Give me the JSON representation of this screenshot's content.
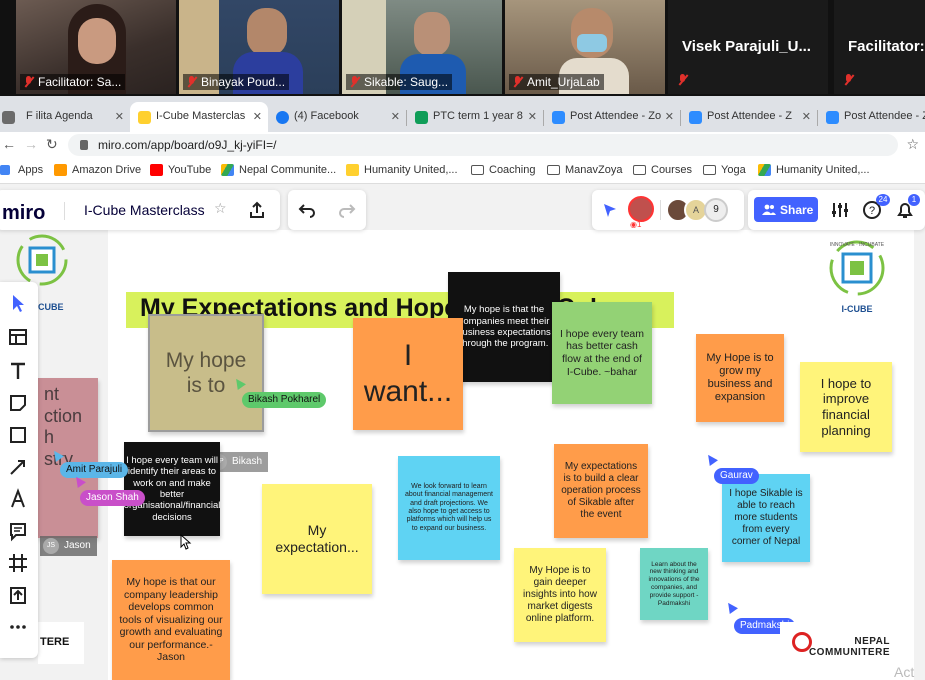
{
  "zoom": {
    "participants": [
      {
        "label": "Facilitator: Sa...",
        "bg": "#5a4a44"
      },
      {
        "label": "Binayak Poud...",
        "bg": "#3e4c63"
      },
      {
        "label": "Sikable: Saug...",
        "bg": "#4b5a55"
      },
      {
        "label": "Amit_UrjaLab",
        "bg": "#7a6a58"
      }
    ],
    "name_tiles": [
      "Visek Parajuli_U...",
      "Facilitator:"
    ]
  },
  "tabs": [
    {
      "label": "F   ilita   Agenda",
      "fav": "#6b6b6b"
    },
    {
      "label": "I-Cube Masterclas",
      "fav": "#ffd02f",
      "active": true
    },
    {
      "label": "(4) Facebook",
      "fav": "#1877f2"
    },
    {
      "label": "PTC term 1 year 8",
      "fav": "#0f9d58"
    },
    {
      "label": "Post Attendee - Zo",
      "fav": "#2d8cff"
    },
    {
      "label": "Post Attendee - Z",
      "fav": "#2d8cff"
    },
    {
      "label": "Post Attendee - Z",
      "fav": "#2d8cff"
    }
  ],
  "address": {
    "url": "miro.com/app/board/o9J_kj-yiFI=/"
  },
  "bookmarks": [
    {
      "label": "Apps",
      "color": "#4285f4",
      "folder": false
    },
    {
      "label": "Amazon Drive",
      "color": "#ff9900",
      "folder": false
    },
    {
      "label": "YouTube",
      "color": "#ff0000",
      "folder": false
    },
    {
      "label": "Nepal Communite...",
      "color": "#34a853",
      "folder": false
    },
    {
      "label": "Humanity United,...",
      "color": "#ffd02f",
      "folder": false
    },
    {
      "label": "Coaching",
      "color": "#555",
      "folder": true
    },
    {
      "label": "ManavZoya",
      "color": "#555",
      "folder": true
    },
    {
      "label": "Courses",
      "color": "#555",
      "folder": true
    },
    {
      "label": "Yoga",
      "color": "#555",
      "folder": true
    },
    {
      "label": "Humanity United,...",
      "color": "#34a853",
      "folder": false
    }
  ],
  "miro": {
    "logo": "miro",
    "board_title": "I-Cube Masterclass",
    "share_label": "Share",
    "online_count": "9",
    "eye_count": "1",
    "help_badge": "24",
    "notif_badge": "1",
    "accent": "#4262ff"
  },
  "board": {
    "heading": "My Expectations and Hopes from I-Cube",
    "logo_text": "CUBE",
    "logo_caption": "I-CUBE",
    "logo_arc": "INNOVATE · INCUBATE",
    "left_partial_text": "nt\nction\nh\nstry",
    "left_partial_user": "Jason",
    "partial_logo_text": "TERE",
    "stickies": [
      {
        "text": "My hope is to",
        "bg": "#c8bd8a"
      },
      {
        "text": "My hope is that the companies meet their business expectations through the program.",
        "bg": "#111111"
      },
      {
        "text": "I want...",
        "bg": "#ff9c4a"
      },
      {
        "text": "I hope every team has better cash flow at the end of I-Cube. ~bahar",
        "bg": "#93d275"
      },
      {
        "text": "My Hope is to grow my business and expansion",
        "bg": "#ff9c4a"
      },
      {
        "text": "I hope to improve financial planning",
        "bg": "#fff47a"
      },
      {
        "text": "I hope every team will identify their areas to work on and make better organisational/financial decisions",
        "bg": "#111111"
      },
      {
        "text": "My expectation...",
        "bg": "#fff47a"
      },
      {
        "text": "We look forward to learn about financial management and draft projections. We also hope to get access to platforms which will help us to expand our business.",
        "bg": "#5fd3f3"
      },
      {
        "text": "My expectations is to build a clear operation process of Sikable after the event",
        "bg": "#ff9c4a"
      },
      {
        "text": "I hope Sikable is able to reach more students from every corner of Nepal",
        "bg": "#5fd3f3"
      },
      {
        "text": "My hope is that our company leadership develops common tools of visualizing our growth and evaluating our performance.-Jason",
        "bg": "#ff9c4a"
      },
      {
        "text": "My Hope is to gain deeper insights into how market digests online platform.",
        "bg": "#fff47a"
      },
      {
        "text": "Learn about the new thinking and innovations of the companies, and provide support -Padmakshi",
        "bg": "#6fd6c4"
      }
    ],
    "cursors": [
      {
        "name": "Bikash Pokharel",
        "color": "#5ec96b"
      },
      {
        "name": "Amit Parajuli",
        "color": "#5bb6e8"
      },
      {
        "name": "Jason Shah",
        "color": "#c94fc9"
      },
      {
        "name": "Gaurav",
        "color": "#4262ff"
      },
      {
        "name": "Padmakshi",
        "color": "#4262ff"
      }
    ],
    "user_chips": [
      {
        "name": "Bikash",
        "initials": "BP"
      }
    ],
    "footer_logo": "NEPAL COMMUNITERE",
    "corner_text": "Act"
  }
}
